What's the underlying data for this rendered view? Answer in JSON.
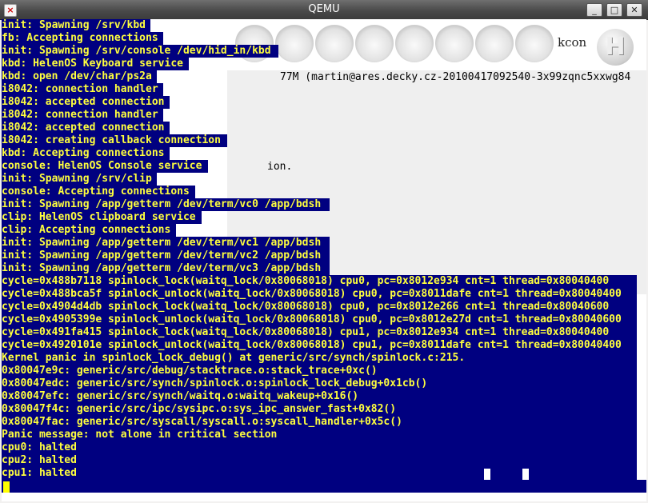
{
  "window": {
    "title": "QEMU",
    "buttons": {
      "minimize": "_",
      "maximize": "□",
      "close": "✕"
    },
    "app_icon": "qemu-icon"
  },
  "background": {
    "kcon_label": "kcon",
    "logo_letter": "H",
    "version_fragment": "77M (martin@ares.decky.cz-20100417092540-3x99zqnc5xxwg84",
    "fragment_2": "ion."
  },
  "console_lines": [
    "init: Spawning /srv/kbd",
    "fb: Accepting connections",
    "init: Spawning /srv/console /dev/hid_in/kbd",
    "kbd: HelenOS Keyboard service",
    "kbd: open /dev/char/ps2a",
    "i8042: connection handler",
    "i8042: accepted connection",
    "i8042: connection handler",
    "i8042: accepted connection",
    "i8042: creating callback connection",
    "kbd: Accepting connections",
    "console: HelenOS Console service",
    "init: Spawning /srv/clip",
    "console: Accepting connections",
    "init: Spawning /app/getterm /dev/term/vc0 /app/bdsh",
    "clip: HelenOS clipboard service",
    "clip: Accepting connections",
    "init: Spawning /app/getterm /dev/term/vc1 /app/bdsh",
    "init: Spawning /app/getterm /dev/term/vc2 /app/bdsh",
    "init: Spawning /app/getterm /dev/term/vc3 /app/bdsh",
    "cycle=0x488b7118 spinlock_lock(waitq_lock/0x80068018) cpu0, pc=0x8012e934 cnt=1 thread=0x80040400",
    "cycle=0x488bca5f spinlock_unlock(waitq_lock/0x80068018) cpu0, pc=0x8011dafe cnt=1 thread=0x80040400",
    "cycle=0x4904d4db spinlock_lock(waitq_lock/0x80068018) cpu0, pc=0x8012e266 cnt=1 thread=0x80040600",
    "cycle=0x4905399e spinlock_unlock(waitq_lock/0x80068018) cpu0, pc=0x8012e27d cnt=1 thread=0x80040600",
    "cycle=0x491fa415 spinlock_lock(waitq_lock/0x80068018) cpu1, pc=0x8012e934 cnt=1 thread=0x80040400",
    "cycle=0x4920101e spinlock_unlock(waitq_lock/0x80068018) cpu1, pc=0x8011dafe cnt=1 thread=0x80040400",
    "Kernel panic in spinlock_lock_debug() at generic/src/synch/spinlock.c:215.",
    "0x80047e9c: generic/src/debug/stacktrace.o:stack_trace+0xc()",
    "0x80047edc: generic/src/synch/spinlock.o:spinlock_lock_debug+0x1cb()",
    "0x80047efc: generic/src/synch/waitq.o:waitq_wakeup+0x16()",
    "0x80047f4c: generic/src/ipc/sysipc.o:sys_ipc_answer_fast+0x82()",
    "0x80047fac: generic/src/syscall/syscall.o:syscall_handler+0x5c()",
    "Panic message: not alone in critical section",
    "cpu0: halted",
    "cpu2: halted",
    "cpu1: halted"
  ],
  "colors": {
    "console_bg": "#000080",
    "console_fg": "#ffff3d"
  }
}
